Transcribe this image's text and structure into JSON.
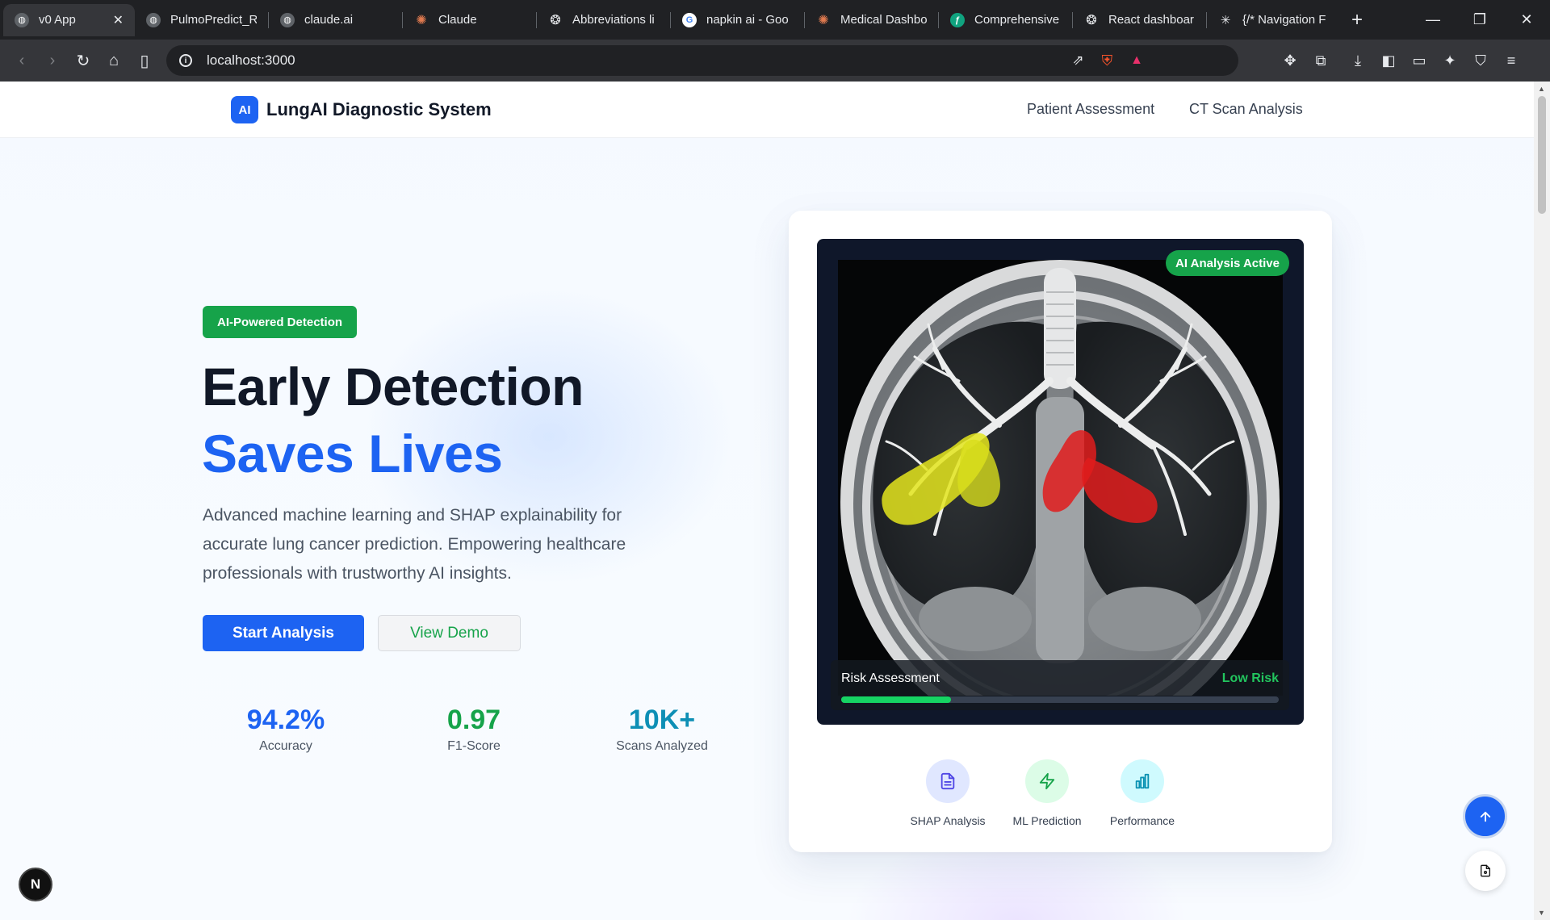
{
  "browser": {
    "tabs": [
      {
        "title": "v0 App",
        "icon": "globe-icon",
        "active": true
      },
      {
        "title": "PulmoPredict_R",
        "icon": "globe-icon"
      },
      {
        "title": "claude.ai",
        "icon": "globe-icon"
      },
      {
        "title": "Claude",
        "icon": "claude-icon"
      },
      {
        "title": "Abbreviations li",
        "icon": "openai-icon"
      },
      {
        "title": "napkin ai - Goo",
        "icon": "google-icon"
      },
      {
        "title": "Medical Dashbo",
        "icon": "claude-icon"
      },
      {
        "title": "Comprehensive",
        "icon": "feather-icon"
      },
      {
        "title": "React dashboar",
        "icon": "openai-icon"
      },
      {
        "title": "{/* Navigation F",
        "icon": "perplexity-icon"
      }
    ],
    "url": "localhost:3000"
  },
  "header": {
    "logo_mark": "AI",
    "logo_text": "LungAI Diagnostic System",
    "nav": [
      "Patient Assessment",
      "CT Scan Analysis"
    ]
  },
  "hero": {
    "badge": "AI-Powered Detection",
    "title_line1": "Early Detection",
    "title_line2": "Saves Lives",
    "description": "Advanced machine learning and SHAP explainability for accurate lung cancer prediction. Empowering healthcare professionals with trustworthy AI insights.",
    "primary_button": "Start Analysis",
    "secondary_button": "View Demo",
    "stats": [
      {
        "value": "94.2%",
        "label": "Accuracy",
        "color": "#1d63f2"
      },
      {
        "value": "0.97",
        "label": "F1-Score",
        "color": "#16a34a"
      },
      {
        "value": "10K+",
        "label": "Scans Analyzed",
        "color": "#0e8fb5"
      }
    ]
  },
  "scan_card": {
    "status_badge": "AI Analysis Active",
    "risk_title": "Risk Assessment",
    "risk_level": "Low Risk",
    "risk_fraction": 0.25,
    "features": [
      {
        "label": "SHAP Analysis",
        "icon": "document-icon",
        "bg": "#e0e7ff",
        "color": "#4f46e5"
      },
      {
        "label": "ML Prediction",
        "icon": "lightning-icon",
        "bg": "#dcfce7",
        "color": "#16a34a"
      },
      {
        "label": "Performance",
        "icon": "bar-chart-icon",
        "bg": "#cffafe",
        "color": "#0891b2"
      }
    ]
  },
  "floating": {
    "next_badge": "N"
  },
  "colors": {
    "primary": "#1d63f2",
    "success": "#16a34a",
    "text_dark": "#111827"
  }
}
